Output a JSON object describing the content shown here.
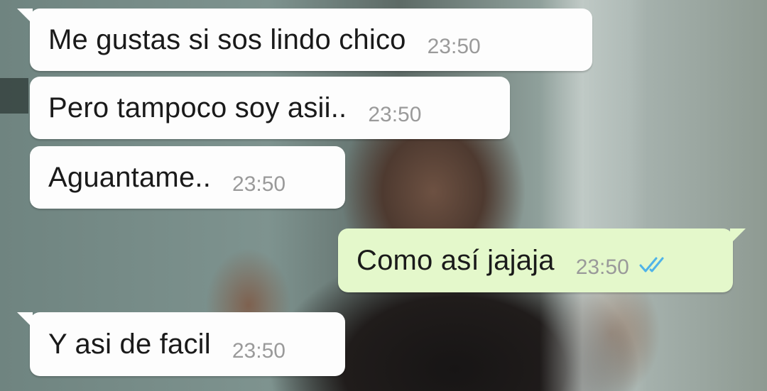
{
  "messages": [
    {
      "direction": "incoming",
      "text": "Me gustas si sos lindo chico",
      "time": "23:50"
    },
    {
      "direction": "incoming",
      "text": "Pero tampoco soy asii..",
      "time": "23:50"
    },
    {
      "direction": "incoming",
      "text": "Aguantame..",
      "time": "23:50"
    },
    {
      "direction": "outgoing",
      "text": "Como así jajaja",
      "time": "23:50",
      "status": "read",
      "status_icon": "double-check-icon"
    },
    {
      "direction": "incoming",
      "text": "Y asi de facil",
      "time": "23:50"
    }
  ],
  "colors": {
    "incoming_bubble": "#fdfdfd",
    "outgoing_bubble": "#e4f8cb",
    "read_ticks": "#4fb3e8",
    "timestamp": "#9a9a9a"
  }
}
